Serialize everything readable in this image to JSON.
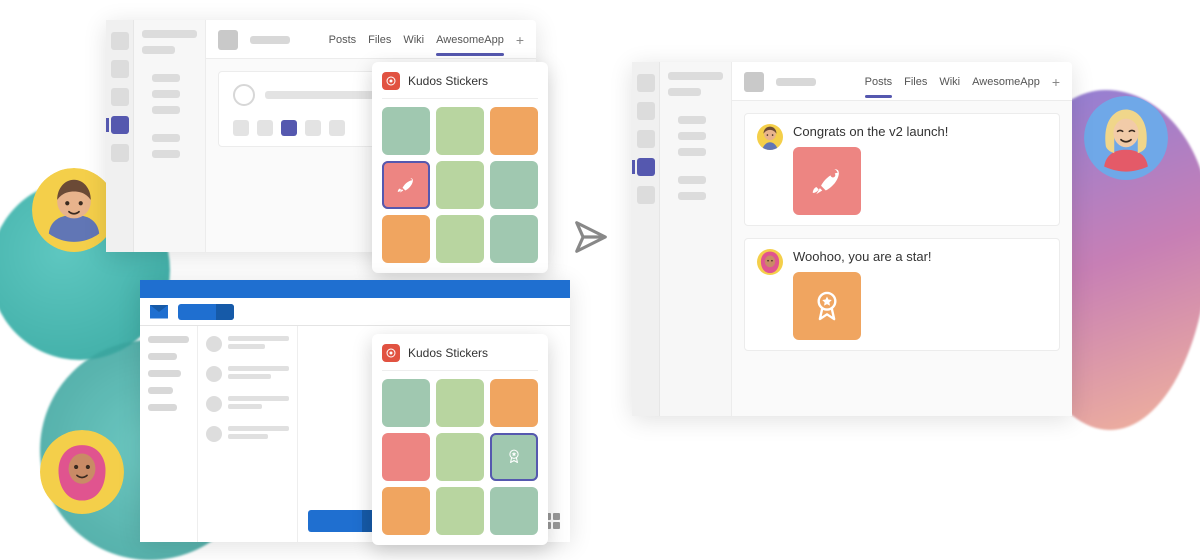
{
  "tabs": {
    "posts": "Posts",
    "files": "Files",
    "wiki": "Wiki",
    "awesome": "AwesomeApp",
    "plus": "+"
  },
  "sticker_panel": {
    "title": "Kudos Stickers",
    "colors": [
      "#a0c8b0",
      "#b8d5a0",
      "#f0a560",
      "#ed8582",
      "#b8d5a0",
      "#a0c8b0",
      "#f0a560",
      "#b8d5a0",
      "#a0c8b0"
    ],
    "selected_rocket_index": 3,
    "selected_badge_index": 5
  },
  "messages": {
    "m1": "Congrats on the v2 launch!",
    "m2": "Woohoo, you are a star!"
  },
  "sticker_colors": {
    "rocket": "#ed8582",
    "badge": "#f0a560"
  }
}
